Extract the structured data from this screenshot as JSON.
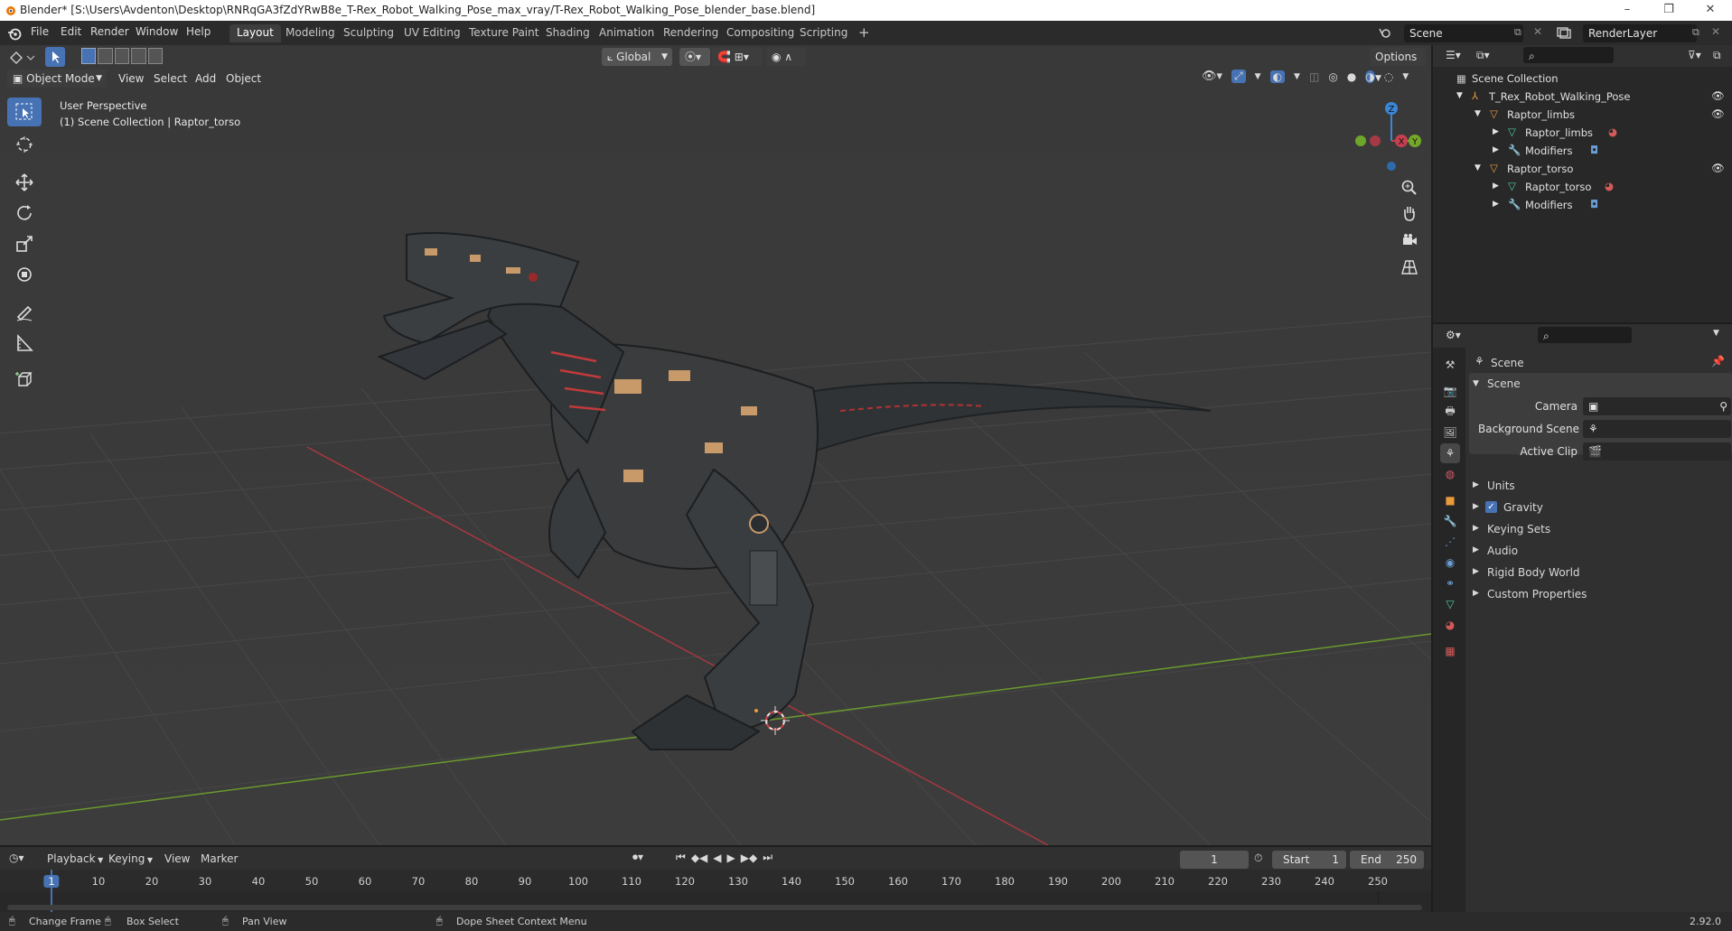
{
  "titlebar": {
    "title": "Blender* [S:\\Users\\Avdenton\\Desktop\\RNRqGA3fZdYRwB8e_T-Rex_Robot_Walking_Pose_max_vray/T-Rex_Robot_Walking_Pose_blender_base.blend]"
  },
  "menu": [
    "File",
    "Edit",
    "Render",
    "Window",
    "Help"
  ],
  "workspaces": [
    "Layout",
    "Modeling",
    "Sculpting",
    "UV Editing",
    "Texture Paint",
    "Shading",
    "Animation",
    "Rendering",
    "Compositing",
    "Scripting"
  ],
  "scene_field": "Scene",
  "renderlayer_field": "RenderLayer",
  "viewport": {
    "transform_orientation": "Global",
    "options_label": "Options",
    "mode": "Object Mode",
    "header_menus": [
      "View",
      "Select",
      "Add",
      "Object"
    ],
    "overlay_title": "User Perspective",
    "overlay_subtitle": "(1) Scene Collection | Raptor_torso",
    "gizmo": {
      "z": "Z",
      "x": "X",
      "y": "Y"
    }
  },
  "outliner": {
    "root": "Scene Collection",
    "items": [
      {
        "label": "T_Rex_Robot_Walking_Pose",
        "depth": 0
      },
      {
        "label": "Raptor_limbs",
        "depth": 1
      },
      {
        "label": "Raptor_limbs",
        "depth": 2
      },
      {
        "label": "Modifiers",
        "depth": 2
      },
      {
        "label": "Raptor_torso",
        "depth": 1
      },
      {
        "label": "Raptor_torso",
        "depth": 2
      },
      {
        "label": "Modifiers",
        "depth": 2
      }
    ]
  },
  "properties": {
    "context": "Scene",
    "panel": "Scene",
    "fields": [
      "Camera",
      "Background Scene",
      "Active Clip"
    ],
    "subpanels": [
      "Units",
      "Gravity",
      "Keying Sets",
      "Audio",
      "Rigid Body World",
      "Custom Properties"
    ]
  },
  "timeline": {
    "menus": [
      "Playback",
      "Keying",
      "View",
      "Marker"
    ],
    "current_frame": "1",
    "start_label": "Start",
    "start_value": "1",
    "end_label": "End",
    "end_value": "250",
    "ticks": [
      "1",
      "10",
      "20",
      "30",
      "40",
      "50",
      "60",
      "70",
      "80",
      "90",
      "100",
      "110",
      "120",
      "130",
      "140",
      "150",
      "160",
      "170",
      "180",
      "190",
      "200",
      "210",
      "220",
      "230",
      "240",
      "250"
    ]
  },
  "statusbar": {
    "items": [
      "Change Frame",
      "Box Select",
      "Pan View",
      "Dope Sheet Context Menu"
    ],
    "version": "2.92.0"
  },
  "colors": {
    "accent": "#4772b3",
    "x_axis": "#c7404f",
    "y_axis": "#76a828",
    "z_axis": "#3b87d6"
  }
}
